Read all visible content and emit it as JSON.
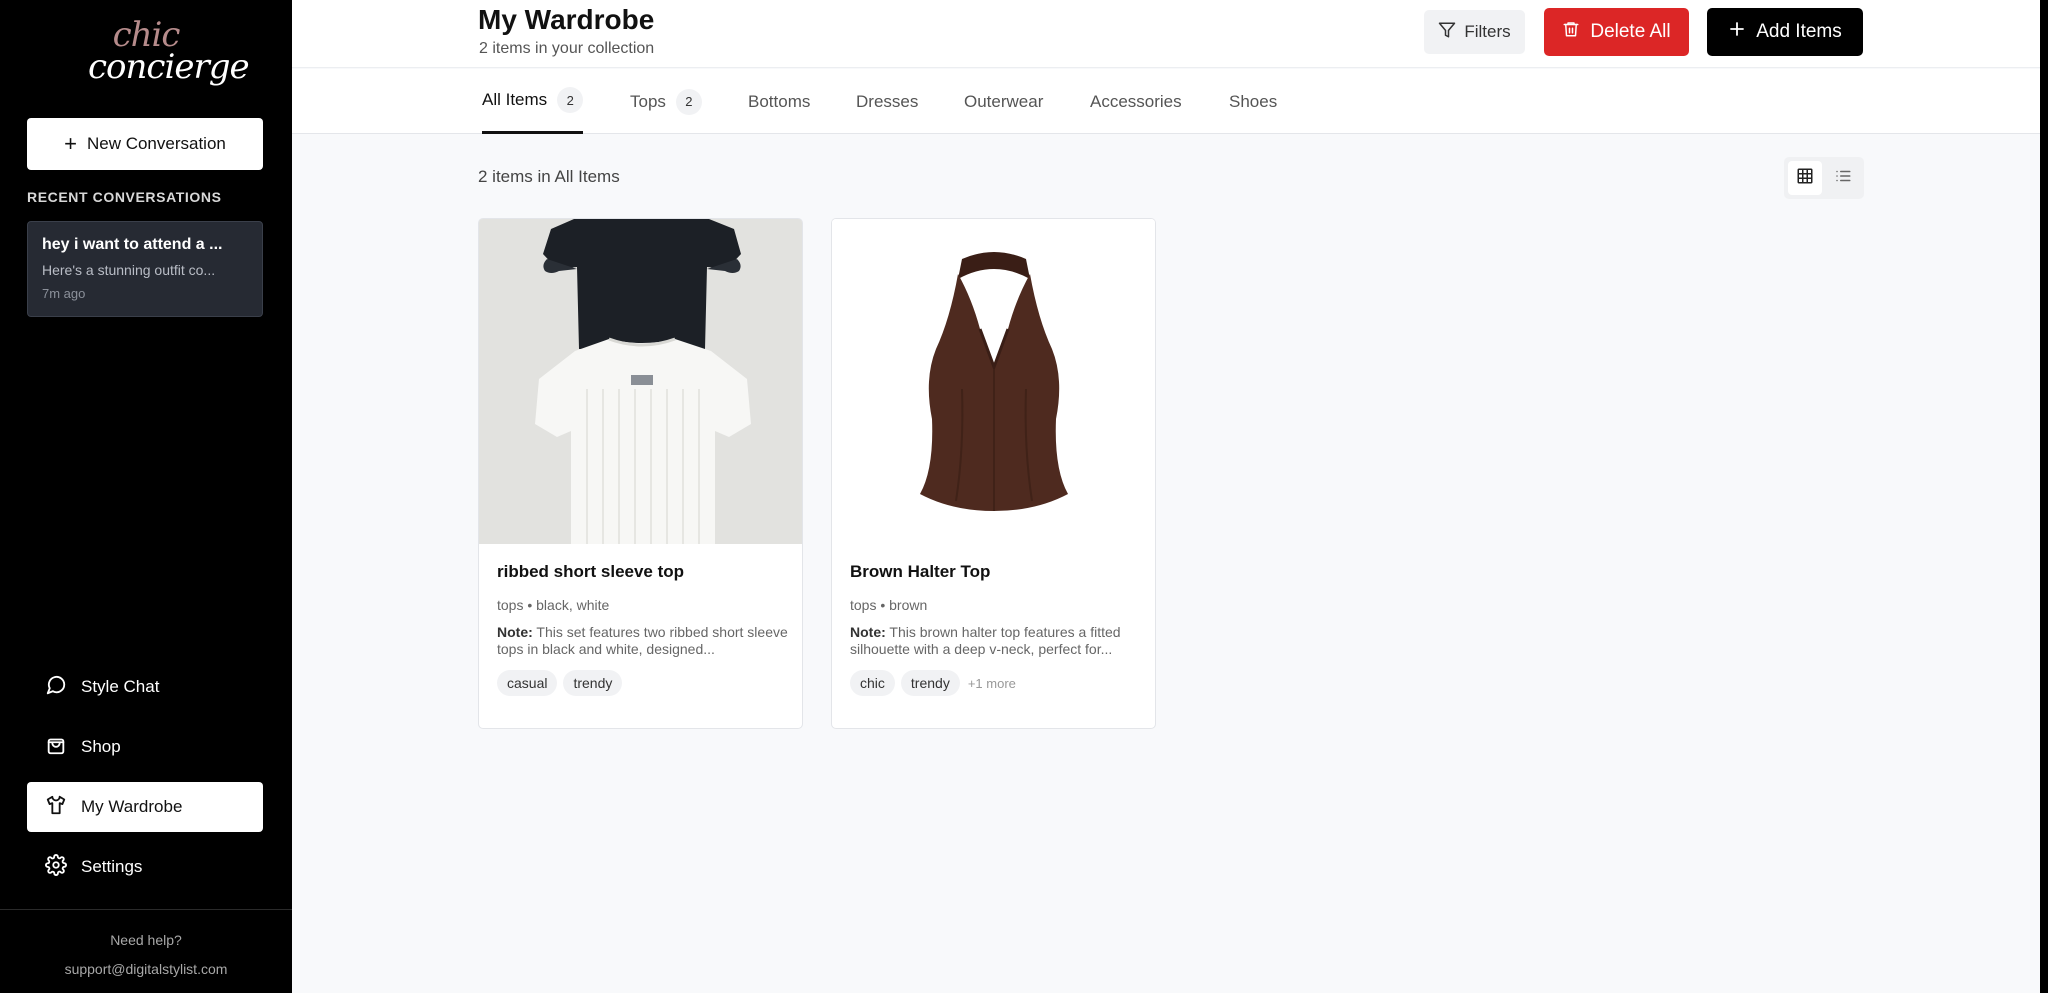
{
  "brand": {
    "line1": "chic",
    "line2": "concierge"
  },
  "sidebar": {
    "new_conversation": "New Conversation",
    "recent_title": "RECENT CONVERSATIONS",
    "conversations": [
      {
        "title": "hey i want to attend a ...",
        "preview": "Here's a stunning outfit co...",
        "time": "7m ago"
      }
    ],
    "nav": [
      {
        "label": "Style Chat",
        "icon": "chat-bubble-icon"
      },
      {
        "label": "Shop",
        "icon": "shopping-bag-icon"
      },
      {
        "label": "My Wardrobe",
        "icon": "shirt-icon",
        "active": true
      },
      {
        "label": "Settings",
        "icon": "gear-icon"
      }
    ],
    "help_text": "Need help?",
    "support_email": "support@digitalstylist.com"
  },
  "header": {
    "title": "My Wardrobe",
    "subtitle": "2 items in your collection",
    "filters_label": "Filters",
    "delete_label": "Delete All",
    "add_label": "Add Items"
  },
  "tabs": [
    {
      "label": "All Items",
      "count": "2",
      "active": true
    },
    {
      "label": "Tops",
      "count": "2"
    },
    {
      "label": "Bottoms"
    },
    {
      "label": "Dresses"
    },
    {
      "label": "Outerwear"
    },
    {
      "label": "Accessories"
    },
    {
      "label": "Shoes"
    }
  ],
  "content": {
    "items_count": "2 items in All Items",
    "items": [
      {
        "name": "ribbed short sleeve top",
        "meta": "tops • black, white",
        "note_label": "Note:",
        "note": "This set features two ribbed short sleeve tops in black and white, designed...",
        "tags": [
          "casual",
          "trendy"
        ]
      },
      {
        "name": "Brown Halter Top",
        "meta": "tops • brown",
        "note_label": "Note:",
        "note": "This brown halter top features a fitted silhouette with a deep v-neck, perfect for...",
        "tags": [
          "chic",
          "trendy"
        ],
        "more": "+1 more"
      }
    ]
  },
  "colors": {
    "accent_red": "#dc2626",
    "sidebar_bg": "#000000",
    "main_bg": "#f8f9fb"
  }
}
